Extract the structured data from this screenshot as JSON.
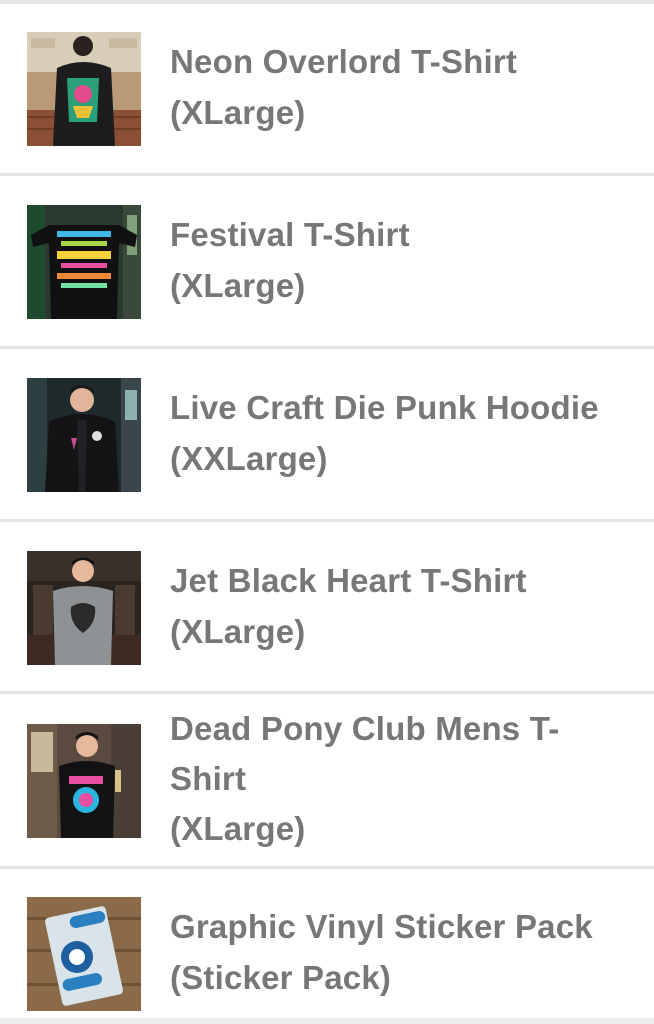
{
  "cart": {
    "items": [
      {
        "name_line1": "Neon Overlord T-Shirt",
        "name_line2": "",
        "variant": "(XLarge)",
        "image_icon": "neon-overlord-tshirt-photo"
      },
      {
        "name_line1": "Festival T-Shirt",
        "name_line2": "",
        "variant": "(XLarge)",
        "image_icon": "festival-tshirt-photo"
      },
      {
        "name_line1": "Live Craft Die Punk Hoodie",
        "name_line2": "",
        "variant": "(XXLarge)",
        "image_icon": "hoodie-photo"
      },
      {
        "name_line1": "Jet Black Heart T-Shirt",
        "name_line2": "",
        "variant": "(XLarge)",
        "image_icon": "jet-black-heart-tshirt-photo"
      },
      {
        "name_line1": "Dead Pony Club Mens T-",
        "name_line2": "Shirt",
        "variant": "(XLarge)",
        "image_icon": "dead-pony-club-tshirt-photo"
      },
      {
        "name_line1": "Graphic Vinyl Sticker Pack",
        "name_line2": "",
        "variant": "(Sticker Pack)",
        "image_icon": "sticker-pack-photo"
      }
    ]
  },
  "colors": {
    "title_text": "#777777",
    "divider": "#e4e4e4",
    "background": "#ffffff"
  }
}
